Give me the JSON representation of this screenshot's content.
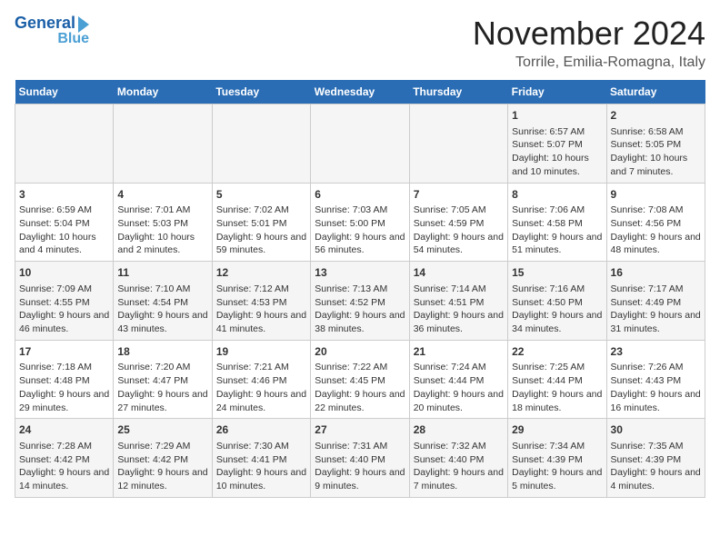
{
  "header": {
    "logo_line1": "General",
    "logo_line2": "Blue",
    "month": "November 2024",
    "location": "Torrile, Emilia-Romagna, Italy"
  },
  "days_of_week": [
    "Sunday",
    "Monday",
    "Tuesday",
    "Wednesday",
    "Thursday",
    "Friday",
    "Saturday"
  ],
  "weeks": [
    [
      {
        "day": "",
        "info": ""
      },
      {
        "day": "",
        "info": ""
      },
      {
        "day": "",
        "info": ""
      },
      {
        "day": "",
        "info": ""
      },
      {
        "day": "",
        "info": ""
      },
      {
        "day": "1",
        "info": "Sunrise: 6:57 AM\nSunset: 5:07 PM\nDaylight: 10 hours and 10 minutes."
      },
      {
        "day": "2",
        "info": "Sunrise: 6:58 AM\nSunset: 5:05 PM\nDaylight: 10 hours and 7 minutes."
      }
    ],
    [
      {
        "day": "3",
        "info": "Sunrise: 6:59 AM\nSunset: 5:04 PM\nDaylight: 10 hours and 4 minutes."
      },
      {
        "day": "4",
        "info": "Sunrise: 7:01 AM\nSunset: 5:03 PM\nDaylight: 10 hours and 2 minutes."
      },
      {
        "day": "5",
        "info": "Sunrise: 7:02 AM\nSunset: 5:01 PM\nDaylight: 9 hours and 59 minutes."
      },
      {
        "day": "6",
        "info": "Sunrise: 7:03 AM\nSunset: 5:00 PM\nDaylight: 9 hours and 56 minutes."
      },
      {
        "day": "7",
        "info": "Sunrise: 7:05 AM\nSunset: 4:59 PM\nDaylight: 9 hours and 54 minutes."
      },
      {
        "day": "8",
        "info": "Sunrise: 7:06 AM\nSunset: 4:58 PM\nDaylight: 9 hours and 51 minutes."
      },
      {
        "day": "9",
        "info": "Sunrise: 7:08 AM\nSunset: 4:56 PM\nDaylight: 9 hours and 48 minutes."
      }
    ],
    [
      {
        "day": "10",
        "info": "Sunrise: 7:09 AM\nSunset: 4:55 PM\nDaylight: 9 hours and 46 minutes."
      },
      {
        "day": "11",
        "info": "Sunrise: 7:10 AM\nSunset: 4:54 PM\nDaylight: 9 hours and 43 minutes."
      },
      {
        "day": "12",
        "info": "Sunrise: 7:12 AM\nSunset: 4:53 PM\nDaylight: 9 hours and 41 minutes."
      },
      {
        "day": "13",
        "info": "Sunrise: 7:13 AM\nSunset: 4:52 PM\nDaylight: 9 hours and 38 minutes."
      },
      {
        "day": "14",
        "info": "Sunrise: 7:14 AM\nSunset: 4:51 PM\nDaylight: 9 hours and 36 minutes."
      },
      {
        "day": "15",
        "info": "Sunrise: 7:16 AM\nSunset: 4:50 PM\nDaylight: 9 hours and 34 minutes."
      },
      {
        "day": "16",
        "info": "Sunrise: 7:17 AM\nSunset: 4:49 PM\nDaylight: 9 hours and 31 minutes."
      }
    ],
    [
      {
        "day": "17",
        "info": "Sunrise: 7:18 AM\nSunset: 4:48 PM\nDaylight: 9 hours and 29 minutes."
      },
      {
        "day": "18",
        "info": "Sunrise: 7:20 AM\nSunset: 4:47 PM\nDaylight: 9 hours and 27 minutes."
      },
      {
        "day": "19",
        "info": "Sunrise: 7:21 AM\nSunset: 4:46 PM\nDaylight: 9 hours and 24 minutes."
      },
      {
        "day": "20",
        "info": "Sunrise: 7:22 AM\nSunset: 4:45 PM\nDaylight: 9 hours and 22 minutes."
      },
      {
        "day": "21",
        "info": "Sunrise: 7:24 AM\nSunset: 4:44 PM\nDaylight: 9 hours and 20 minutes."
      },
      {
        "day": "22",
        "info": "Sunrise: 7:25 AM\nSunset: 4:44 PM\nDaylight: 9 hours and 18 minutes."
      },
      {
        "day": "23",
        "info": "Sunrise: 7:26 AM\nSunset: 4:43 PM\nDaylight: 9 hours and 16 minutes."
      }
    ],
    [
      {
        "day": "24",
        "info": "Sunrise: 7:28 AM\nSunset: 4:42 PM\nDaylight: 9 hours and 14 minutes."
      },
      {
        "day": "25",
        "info": "Sunrise: 7:29 AM\nSunset: 4:42 PM\nDaylight: 9 hours and 12 minutes."
      },
      {
        "day": "26",
        "info": "Sunrise: 7:30 AM\nSunset: 4:41 PM\nDaylight: 9 hours and 10 minutes."
      },
      {
        "day": "27",
        "info": "Sunrise: 7:31 AM\nSunset: 4:40 PM\nDaylight: 9 hours and 9 minutes."
      },
      {
        "day": "28",
        "info": "Sunrise: 7:32 AM\nSunset: 4:40 PM\nDaylight: 9 hours and 7 minutes."
      },
      {
        "day": "29",
        "info": "Sunrise: 7:34 AM\nSunset: 4:39 PM\nDaylight: 9 hours and 5 minutes."
      },
      {
        "day": "30",
        "info": "Sunrise: 7:35 AM\nSunset: 4:39 PM\nDaylight: 9 hours and 4 minutes."
      }
    ]
  ]
}
